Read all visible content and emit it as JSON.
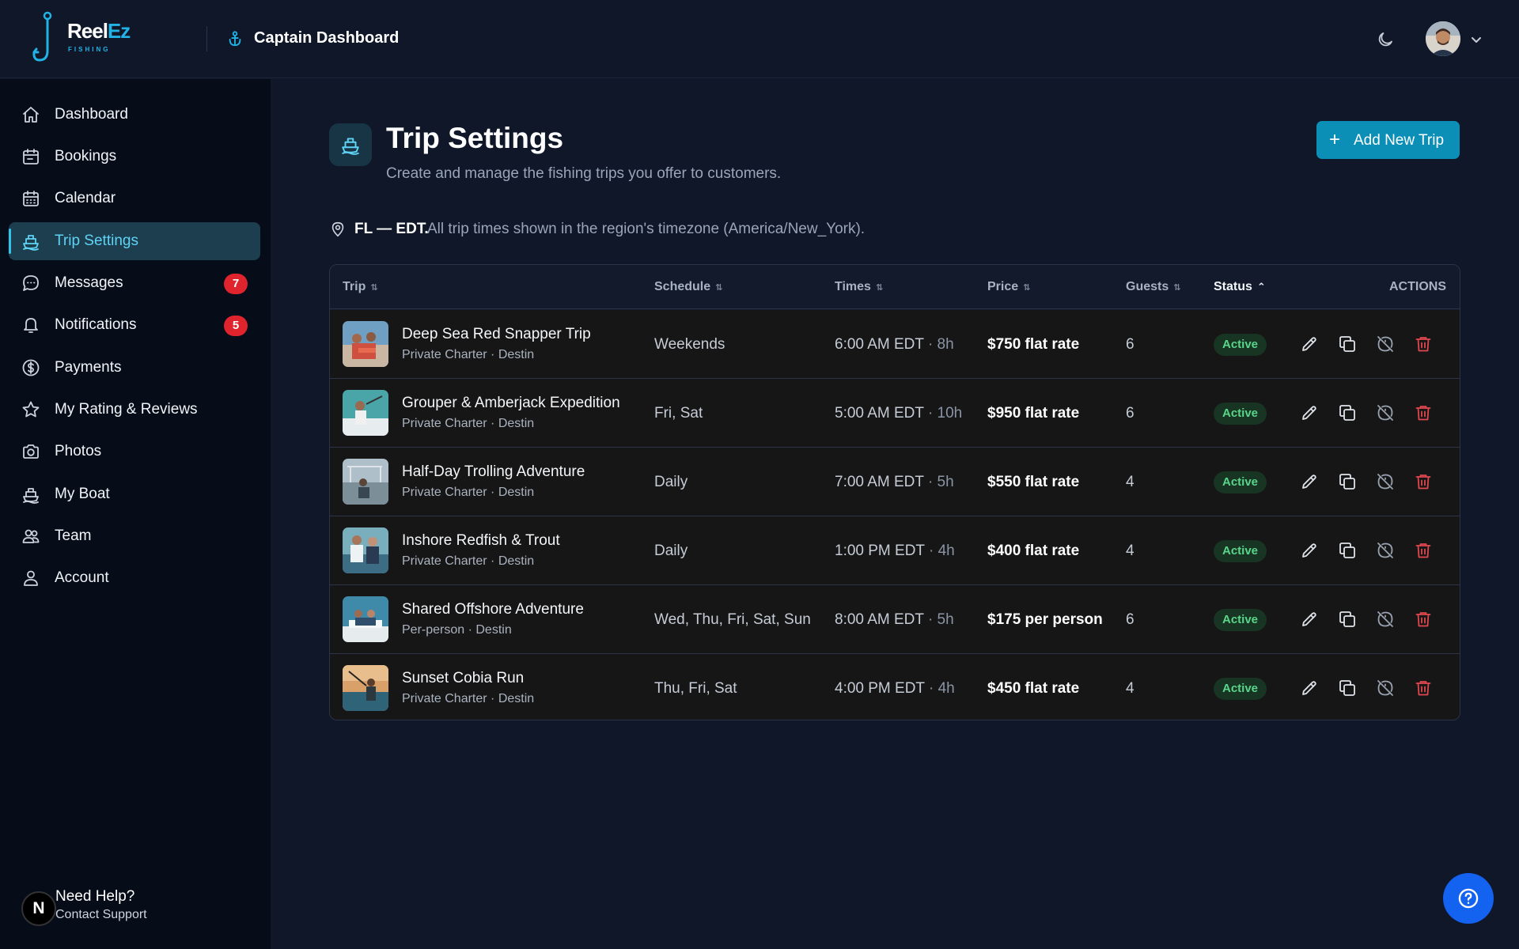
{
  "brand": {
    "name_part1": "Reel",
    "name_part2": "Ez",
    "tagline": "FISHING"
  },
  "topbar": {
    "title": "Captain Dashboard"
  },
  "sidebar": {
    "items": [
      {
        "label": "Dashboard",
        "icon": "home-icon"
      },
      {
        "label": "Bookings",
        "icon": "calendar-check-icon"
      },
      {
        "label": "Calendar",
        "icon": "calendar-grid-icon"
      },
      {
        "label": "Trip Settings",
        "icon": "ship-icon",
        "active": true
      },
      {
        "label": "Messages",
        "icon": "chat-bubble-icon",
        "badge": "7"
      },
      {
        "label": "Notifications",
        "icon": "bell-icon",
        "badge": "5"
      },
      {
        "label": "Payments",
        "icon": "dollar-circle-icon"
      },
      {
        "label": "My Rating & Reviews",
        "icon": "star-icon"
      },
      {
        "label": "Photos",
        "icon": "camera-icon"
      },
      {
        "label": "My Boat",
        "icon": "ship-icon"
      },
      {
        "label": "Team",
        "icon": "users-icon"
      },
      {
        "label": "Account",
        "icon": "user-icon"
      }
    ],
    "help": {
      "initial": "N",
      "title": "Need Help?",
      "subtitle": "Contact Support"
    }
  },
  "page": {
    "title": "Trip Settings",
    "subtitle": "Create and manage the fishing trips you offer to customers.",
    "add_button": "Add New Trip",
    "timezone_strong": "FL — EDT.",
    "timezone_text": "All trip times shown in the region's timezone (America/New_York)."
  },
  "table": {
    "columns": {
      "trip": "Trip",
      "schedule": "Schedule",
      "times": "Times",
      "price": "Price",
      "guests": "Guests",
      "status": "Status",
      "actions": "ACTIONS"
    },
    "rows": [
      {
        "name": "Deep Sea Red Snapper Trip",
        "sub": "Private Charter · Destin",
        "schedule": "Weekends",
        "time": "6:00 AM EDT",
        "duration": "· 8h",
        "price": "$750 flat rate",
        "guests": "6",
        "status": "Active"
      },
      {
        "name": "Grouper & Amberjack Expedition",
        "sub": "Private Charter · Destin",
        "schedule": "Fri, Sat",
        "time": "5:00 AM EDT",
        "duration": "· 10h",
        "price": "$950 flat rate",
        "guests": "6",
        "status": "Active"
      },
      {
        "name": "Half-Day Trolling Adventure",
        "sub": "Private Charter · Destin",
        "schedule": "Daily",
        "time": "7:00 AM EDT",
        "duration": "· 5h",
        "price": "$550 flat rate",
        "guests": "4",
        "status": "Active"
      },
      {
        "name": "Inshore Redfish & Trout",
        "sub": "Private Charter · Destin",
        "schedule": "Daily",
        "time": "1:00 PM EDT",
        "duration": "· 4h",
        "price": "$400 flat rate",
        "guests": "4",
        "status": "Active"
      },
      {
        "name": "Shared Offshore Adventure",
        "sub": "Per-person · Destin",
        "schedule": "Wed, Thu, Fri, Sat, Sun",
        "time": "8:00 AM EDT",
        "duration": "· 5h",
        "price": "$175 per person",
        "guests": "6",
        "status": "Active"
      },
      {
        "name": "Sunset Cobia Run",
        "sub": "Private Charter · Destin",
        "schedule": "Thu, Fri, Sat",
        "time": "4:00 PM EDT",
        "duration": "· 4h",
        "price": "$450 flat rate",
        "guests": "4",
        "status": "Active"
      }
    ]
  },
  "colors": {
    "accent": "#0b8fb7",
    "active_nav_bg": "#1d3e4e",
    "badge_red": "#e0242d",
    "status_green": "#59d68a",
    "delete_red": "#e0474f",
    "help_fab": "#1462f0"
  }
}
